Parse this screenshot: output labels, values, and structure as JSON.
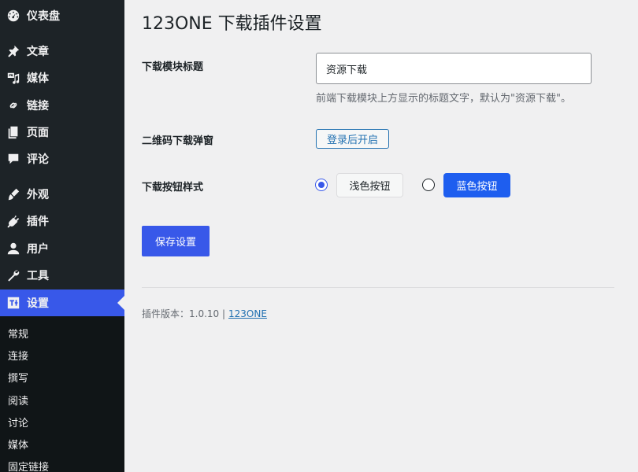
{
  "sidebar": {
    "items": [
      {
        "label": "仪表盘",
        "icon": "dashboard-icon"
      },
      {
        "label": "文章",
        "icon": "pin-icon"
      },
      {
        "label": "媒体",
        "icon": "media-icon"
      },
      {
        "label": "链接",
        "icon": "link-icon"
      },
      {
        "label": "页面",
        "icon": "page-icon"
      },
      {
        "label": "评论",
        "icon": "comment-icon"
      },
      {
        "label": "外观",
        "icon": "brush-icon"
      },
      {
        "label": "插件",
        "icon": "plugin-icon"
      },
      {
        "label": "用户",
        "icon": "user-icon"
      },
      {
        "label": "工具",
        "icon": "wrench-icon"
      },
      {
        "label": "设置",
        "icon": "settings-icon"
      }
    ],
    "active": "设置",
    "submenu": [
      "常规",
      "连接",
      "撰写",
      "阅读",
      "讨论",
      "媒体",
      "固定链接"
    ]
  },
  "page": {
    "title": "123ONE 下载插件设置"
  },
  "form": {
    "title_label": "下载模块标题",
    "title_value": "资源下载",
    "title_desc": "前端下载模块上方显示的标题文字，默认为\"资源下载\"。",
    "qr_label": "二维码下载弹窗",
    "qr_button": "登录后开启",
    "style_label": "下载按钮样式",
    "style_options": [
      {
        "label": "浅色按钮",
        "selected": true
      },
      {
        "label": "蓝色按钮",
        "selected": false
      }
    ],
    "save_button": "保存设置"
  },
  "footer": {
    "version_text": "插件版本：1.0.10 |",
    "link_text": "123ONE"
  },
  "colors": {
    "sidebar_bg": "#1d2327",
    "accent": "#3858e9",
    "blue_button": "#1e5eef"
  }
}
